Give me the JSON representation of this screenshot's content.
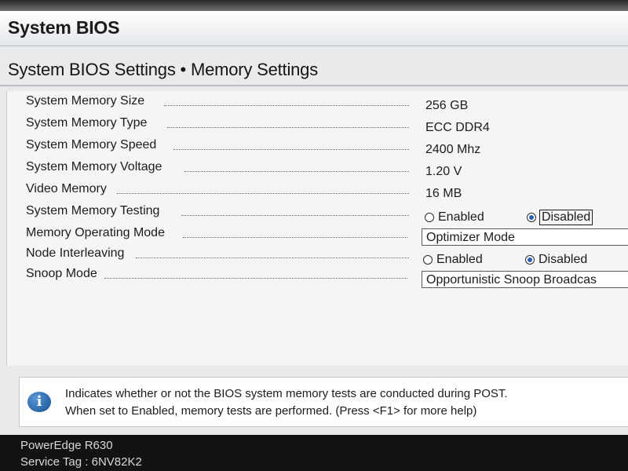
{
  "header": {
    "title": "System BIOS"
  },
  "page": {
    "title": "System BIOS Settings • Memory Settings"
  },
  "settings": {
    "system_memory_size": {
      "label": "System Memory Size",
      "value": "256 GB"
    },
    "system_memory_type": {
      "label": "System Memory Type",
      "value": "ECC DDR4"
    },
    "system_memory_speed": {
      "label": "System Memory Speed",
      "value": "2400 Mhz"
    },
    "system_memory_voltage": {
      "label": "System Memory Voltage",
      "value": "1.20 V"
    },
    "video_memory": {
      "label": "Video Memory",
      "value": "16 MB"
    },
    "system_memory_testing": {
      "label": "System Memory Testing",
      "options": [
        "Enabled",
        "Disabled"
      ],
      "selected": "Disabled"
    },
    "memory_operating_mode": {
      "label": "Memory Operating Mode",
      "value": "Optimizer Mode"
    },
    "node_interleaving": {
      "label": "Node Interleaving",
      "options": [
        "Enabled",
        "Disabled"
      ],
      "selected": "Disabled"
    },
    "snoop_mode": {
      "label": "Snoop Mode",
      "value": "Opportunistic Snoop Broadcas"
    }
  },
  "help": {
    "icon": "info-icon",
    "line1": "Indicates whether or not the BIOS system memory tests are conducted during POST.",
    "line2": "When set to Enabled, memory tests are performed. (Press <F1> for more help)"
  },
  "footer": {
    "model": "PowerEdge R630",
    "service_tag": "Service Tag : 6NV82K2"
  },
  "colors": {
    "background": "#e9eaec",
    "panel": "#f4f5f6",
    "footer": "#121315",
    "radio_selected": "#2a5fb0",
    "info_icon": "#1f64ad"
  }
}
